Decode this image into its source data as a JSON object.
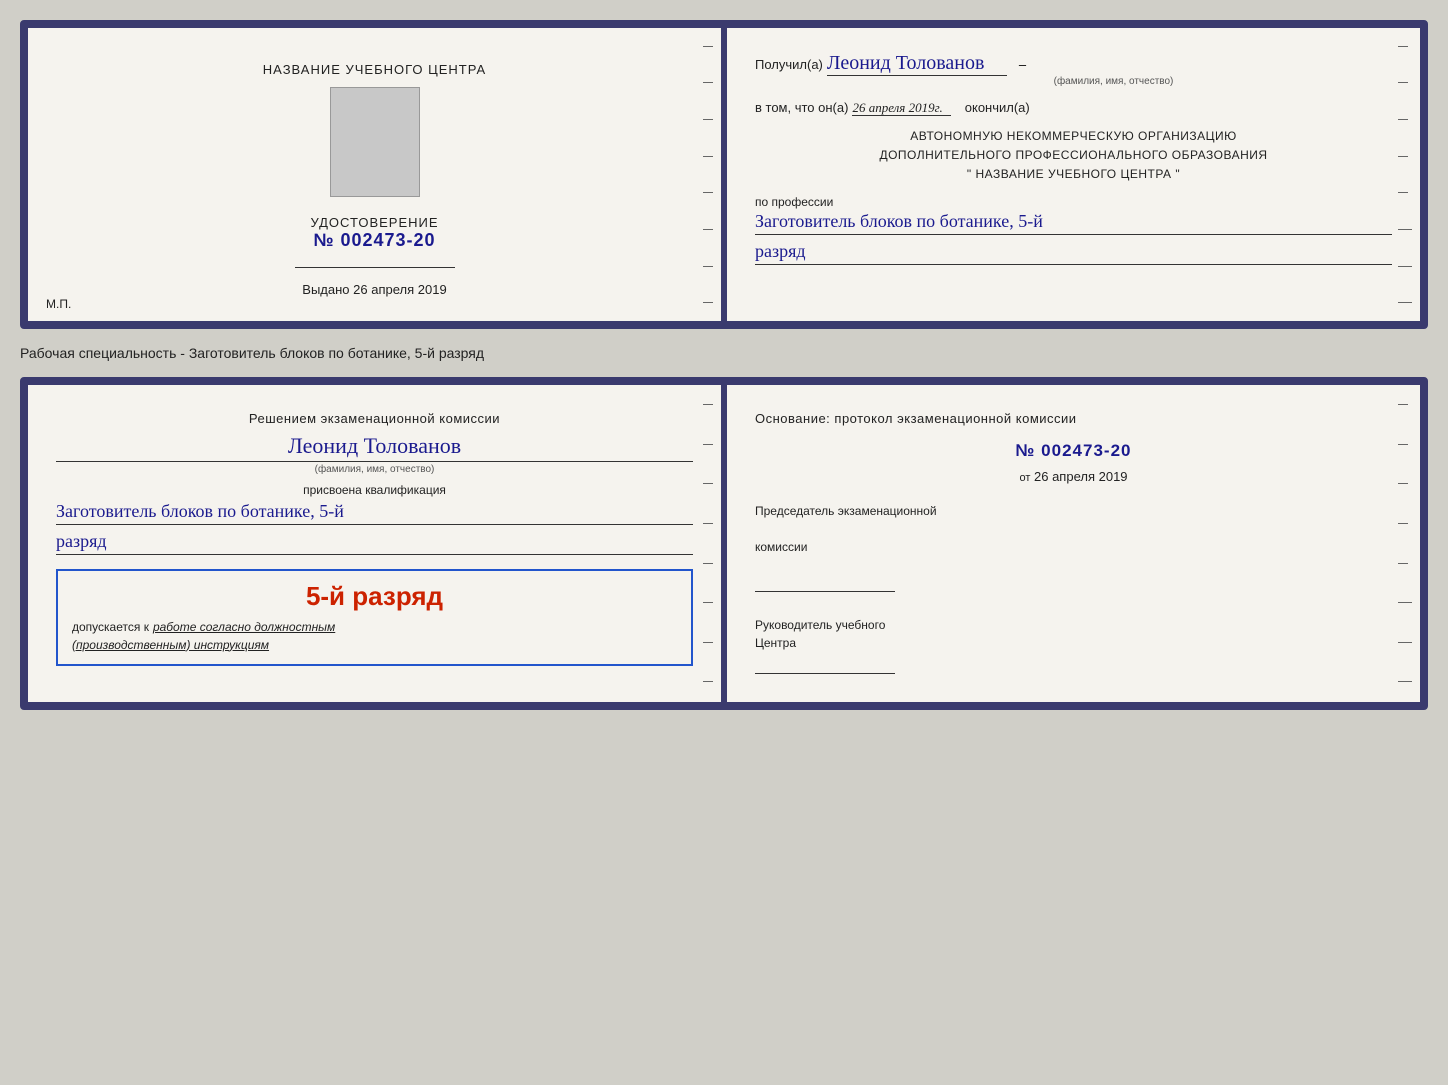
{
  "top_doc": {
    "left": {
      "heading": "НАЗВАНИЕ УЧЕБНОГО ЦЕНТРА",
      "cert_label": "УДОСТОВЕРЕНИЕ",
      "cert_number": "№ 002473-20",
      "issued_label": "Выдано",
      "issued_date": "26 апреля 2019",
      "mp_label": "М.П."
    },
    "right": {
      "recipient_prefix": "Получил(а)",
      "recipient_name": "Леонид Толованов",
      "fio_sub": "(фамилия, имя, отчество)",
      "confirm_prefix": "в том, что он(а)",
      "confirm_date": "26 апреля 2019г.",
      "confirm_suffix": "окончил(а)",
      "org_line1": "АВТОНОМНУЮ НЕКОММЕРЧЕСКУЮ ОРГАНИЗАЦИЮ",
      "org_line2": "ДОПОЛНИТЕЛЬНОГО ПРОФЕССИОНАЛЬНОГО ОБРАЗОВАНИЯ",
      "org_line3": "\"   НАЗВАНИЕ УЧЕБНОГО ЦЕНТРА   \"",
      "profession_label": "по профессии",
      "profession_value": "Заготовитель блоков по ботанике, 5-й",
      "rank_value": "разряд"
    }
  },
  "specialty_label": "Рабочая специальность - Заготовитель блоков по ботанике, 5-й разряд",
  "bottom_doc": {
    "left": {
      "commission_text1": "Решением экзаменационной комиссии",
      "person_name": "Леонид Толованов",
      "fio_sub": "(фамилия, имя, отчество)",
      "qualification_label": "присвоена квалификация",
      "qualification_value": "Заготовитель блоков по ботанике, 5-й",
      "rank_value": "разряд",
      "stamp_rank": "5-й разряд",
      "stamp_allowed_prefix": "допускается к",
      "stamp_italic": "работе согласно должностным",
      "stamp_italic2": "(производственным) инструкциям"
    },
    "right": {
      "basis_text": "Основание: протокол экзаменационной комиссии",
      "protocol_number": "№  002473-20",
      "from_prefix": "от",
      "from_date": "26 апреля 2019",
      "chairman_label1": "Председатель экзаменационной",
      "chairman_label2": "комиссии",
      "director_label1": "Руководитель учебного",
      "director_label2": "Центра"
    }
  }
}
